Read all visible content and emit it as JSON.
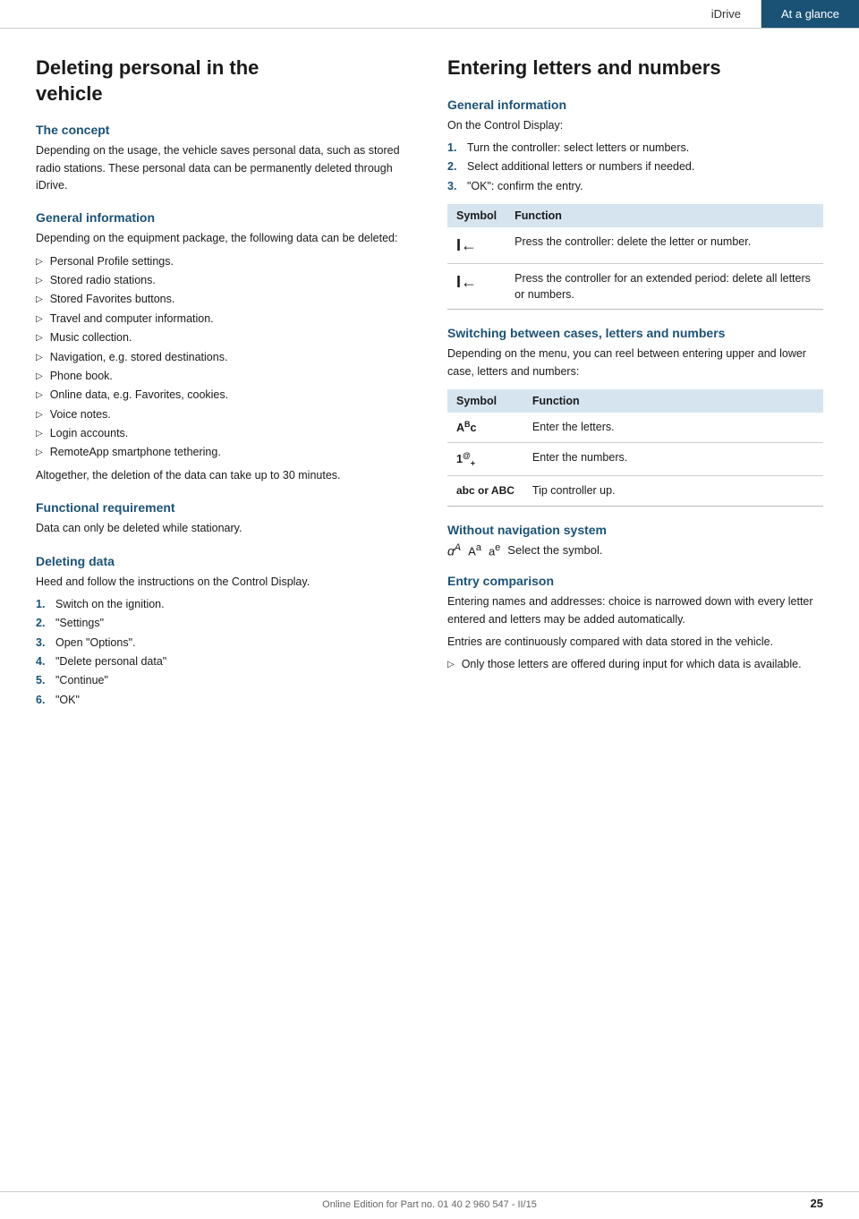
{
  "topbar": {
    "idrive_label": "iDrive",
    "at_glance_label": "At a glance"
  },
  "left": {
    "main_title_line1": "Deleting personal in the",
    "main_title_line2": "vehicle",
    "concept_heading": "The concept",
    "concept_body": "Depending on the usage, the vehicle saves personal data, such as stored radio stations. These personal data can be permanently deleted through iDrive.",
    "general_info_heading": "General information",
    "general_info_body": "Depending on the equipment package, the following data can be deleted:",
    "bullet_items": [
      "Personal Profile settings.",
      "Stored radio stations.",
      "Stored Favorites buttons.",
      "Travel and computer information.",
      "Music collection.",
      "Navigation, e.g. stored destinations.",
      "Phone book.",
      "Online data, e.g. Favorites, cookies.",
      "Voice notes.",
      "Login accounts.",
      "RemoteApp smartphone tethering."
    ],
    "general_info_footer": "Altogether, the deletion of the data can take up to 30 minutes.",
    "functional_req_heading": "Functional requirement",
    "functional_req_body": "Data can only be deleted while stationary.",
    "deleting_data_heading": "Deleting data",
    "deleting_data_body": "Heed and follow the instructions on the Control Display.",
    "steps": [
      {
        "num": "1.",
        "text": "Switch on the ignition."
      },
      {
        "num": "2.",
        "text": "\"Settings\""
      },
      {
        "num": "3.",
        "text": "Open \"Options\"."
      },
      {
        "num": "4.",
        "text": "\"Delete personal data\""
      },
      {
        "num": "5.",
        "text": "\"Continue\""
      },
      {
        "num": "6.",
        "text": "\"OK\""
      }
    ]
  },
  "right": {
    "main_title": "Entering letters and numbers",
    "general_info_heading": "General information",
    "general_info_intro": "On the Control Display:",
    "steps": [
      {
        "num": "1.",
        "text": "Turn the controller: select letters or numbers."
      },
      {
        "num": "2.",
        "text": "Select additional letters or numbers if needed."
      },
      {
        "num": "3.",
        "text": "\"OK\": confirm the entry."
      }
    ],
    "table1": {
      "col1": "Symbol",
      "col2": "Function",
      "rows": [
        {
          "symbol": "I←",
          "function": "Press the controller: delete the letter or number."
        },
        {
          "symbol": "I←",
          "function": "Press the controller for an extended period: delete all letters or numbers."
        }
      ]
    },
    "switching_heading": "Switching between cases, letters and numbers",
    "switching_body": "Depending on the menu, you can reel between entering upper and lower case, letters and numbers:",
    "table2": {
      "col1": "Symbol",
      "col2": "Function",
      "rows": [
        {
          "symbol": "Aᴬc",
          "function": "Enter the letters."
        },
        {
          "symbol": "1®₊",
          "function": "Enter the numbers."
        },
        {
          "symbol": "abc or ABC",
          "function": "Tip controller up."
        }
      ]
    },
    "without_nav_heading": "Without navigation system",
    "without_nav_symbols": "ɑᴬ  Aᵃ  aᵉ",
    "without_nav_text": "Select the symbol.",
    "entry_comparison_heading": "Entry comparison",
    "entry_comparison_body1": "Entering names and addresses: choice is narrowed down with every letter entered and letters may be added automatically.",
    "entry_comparison_body2": "Entries are continuously compared with data stored in the vehicle.",
    "entry_bullet": "Only those letters are offered during input for which data is available."
  },
  "footer": {
    "text": "Online Edition for Part no. 01 40 2 960 547 - II/15",
    "page_number": "25"
  }
}
